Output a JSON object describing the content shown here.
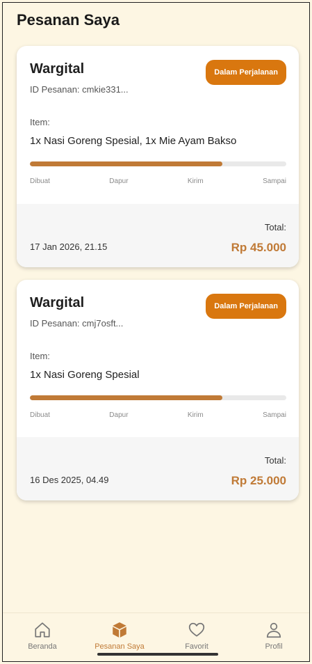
{
  "header": {
    "title": "Pesanan Saya"
  },
  "orders": [
    {
      "shop": "Wargital",
      "order_id": "ID Pesanan: cmkie331...",
      "status": "Dalam Perjalanan",
      "item_label": "Item:",
      "items": "1x Nasi Goreng Spesial, 1x Mie Ayam Bakso",
      "progress": 0.75,
      "steps": [
        "Dibuat",
        "Dapur",
        "Kirim",
        "Sampai"
      ],
      "date": "17 Jan 2026, 21.15",
      "total_label": "Total:",
      "total": "Rp 45.000"
    },
    {
      "shop": "Wargital",
      "order_id": "ID Pesanan: cmj7osft...",
      "status": "Dalam Perjalanan",
      "item_label": "Item:",
      "items": "1x Nasi Goreng Spesial",
      "progress": 0.75,
      "steps": [
        "Dibuat",
        "Dapur",
        "Kirim",
        "Sampai"
      ],
      "date": "16 Des 2025, 04.49",
      "total_label": "Total:",
      "total": "Rp 25.000"
    }
  ],
  "nav": [
    {
      "label": "Beranda",
      "icon": "home-icon",
      "active": false
    },
    {
      "label": "Pesanan Saya",
      "icon": "box-icon",
      "active": true
    },
    {
      "label": "Favorit",
      "icon": "heart-icon",
      "active": false
    },
    {
      "label": "Profil",
      "icon": "user-icon",
      "active": false
    }
  ],
  "colors": {
    "accent": "#c07a36",
    "badge": "#d9770f",
    "background": "#fdf6e3"
  }
}
